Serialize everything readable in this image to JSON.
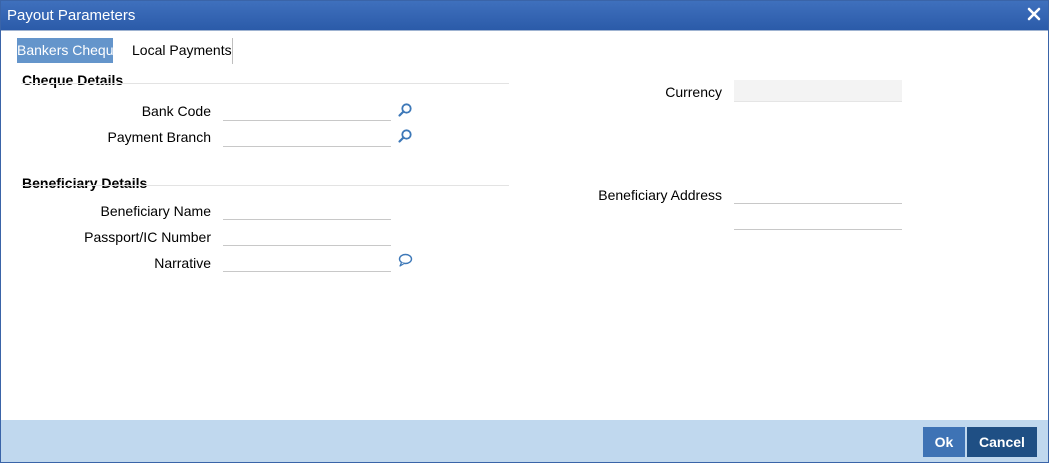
{
  "window": {
    "title": "Payout Parameters"
  },
  "tabs": [
    {
      "label": "Bankers Cheque",
      "active": true
    },
    {
      "label": "Local Payments",
      "active": false
    }
  ],
  "cheque_details": {
    "title": "Cheque Details",
    "bank_code_label": "Bank Code",
    "bank_code_value": "",
    "payment_branch_label": "Payment Branch",
    "payment_branch_value": "",
    "currency_label": "Currency",
    "currency_value": ""
  },
  "beneficiary_details": {
    "title": "Beneficiary Details",
    "name_label": "Beneficiary Name",
    "name_value": "",
    "passport_label": "Passport/IC Number",
    "passport_value": "",
    "narrative_label": "Narrative",
    "narrative_value": "",
    "address_label": "Beneficiary Address",
    "address_line1": "",
    "address_line2": ""
  },
  "footer": {
    "ok_label": "Ok",
    "cancel_label": "Cancel"
  },
  "icons": {
    "lookup": "magnifier-icon",
    "narrative": "speech-bubble-icon",
    "close": "close-icon"
  },
  "colors": {
    "titlebar": "#2b5ba9",
    "active_tab": "#6495cb",
    "footer": "#c0d8ee",
    "ok_button": "#3e73b5",
    "cancel_button": "#1f4f84"
  }
}
